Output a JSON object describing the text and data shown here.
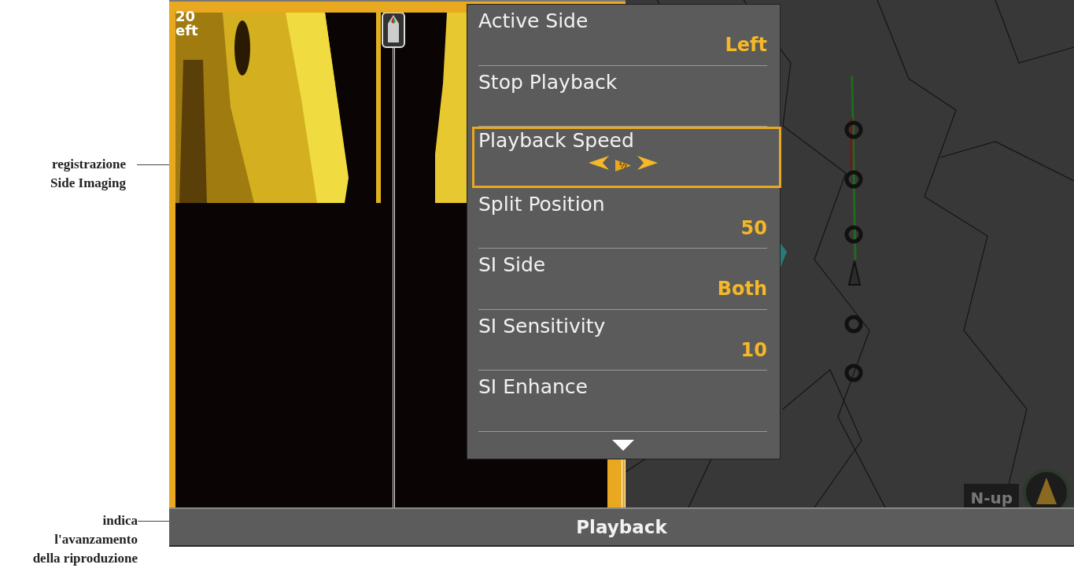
{
  "callouts": [
    {
      "lines": [
        "registrazione",
        "Side Imaging"
      ]
    },
    {
      "lines": [
        "indica",
        "l'avanzamento",
        "della riproduzione"
      ]
    }
  ],
  "sonar": {
    "range": "20",
    "side": "eft"
  },
  "menu": {
    "items": [
      {
        "kind": "setting",
        "label": "Active Side",
        "value": "Left",
        "selected": false
      },
      {
        "kind": "action",
        "label": "Stop Playback",
        "selected": false
      },
      {
        "kind": "stepper",
        "label": "Playback Speed",
        "value": "½",
        "selected": true
      },
      {
        "kind": "setting",
        "label": "Split Position",
        "value": "50",
        "selected": false
      },
      {
        "kind": "setting",
        "label": "SI Side",
        "value": "Both",
        "selected": false
      },
      {
        "kind": "setting",
        "label": "SI Sensitivity",
        "value": "10",
        "selected": false
      },
      {
        "kind": "action",
        "label": "SI Enhance",
        "selected": false
      }
    ]
  },
  "map": {
    "orientation": "N-up"
  },
  "status_bar": {
    "title": "Playback"
  }
}
